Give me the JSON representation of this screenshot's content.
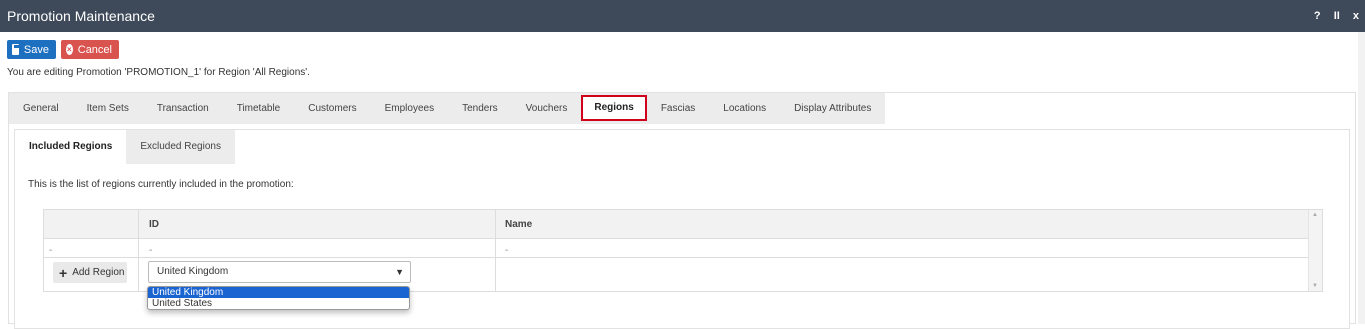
{
  "window": {
    "title": "Promotion Maintenance",
    "controls": [
      "?",
      "II",
      "x"
    ]
  },
  "toolbar": {
    "save_label": "Save",
    "cancel_label": "Cancel"
  },
  "editing_text": "You are editing Promotion 'PROMOTION_1' for Region 'All Regions'.",
  "tabs": [
    {
      "label": "General"
    },
    {
      "label": "Item Sets"
    },
    {
      "label": "Transaction"
    },
    {
      "label": "Timetable"
    },
    {
      "label": "Customers"
    },
    {
      "label": "Employees"
    },
    {
      "label": "Tenders"
    },
    {
      "label": "Vouchers"
    },
    {
      "label": "Regions",
      "active": true
    },
    {
      "label": "Fascias"
    },
    {
      "label": "Locations"
    },
    {
      "label": "Display Attributes"
    }
  ],
  "subtabs": [
    {
      "label": "Included Regions",
      "active": true
    },
    {
      "label": "Excluded Regions"
    }
  ],
  "info_text": "This is the list of regions currently included in the promotion:",
  "grid": {
    "columns": [
      "ID",
      "Name"
    ],
    "row": {
      "action": "-",
      "id": "-",
      "name": "-"
    },
    "add_label": "Add Region"
  },
  "select": {
    "value": "United Kingdom",
    "options": [
      "United Kingdom",
      "United States"
    ]
  },
  "colors": {
    "titlebar": "#3e4a5a",
    "save": "#1d6fc0",
    "cancel": "#d9534f",
    "active_tab_border": "#d0021b",
    "option_highlight": "#1a64d1"
  }
}
